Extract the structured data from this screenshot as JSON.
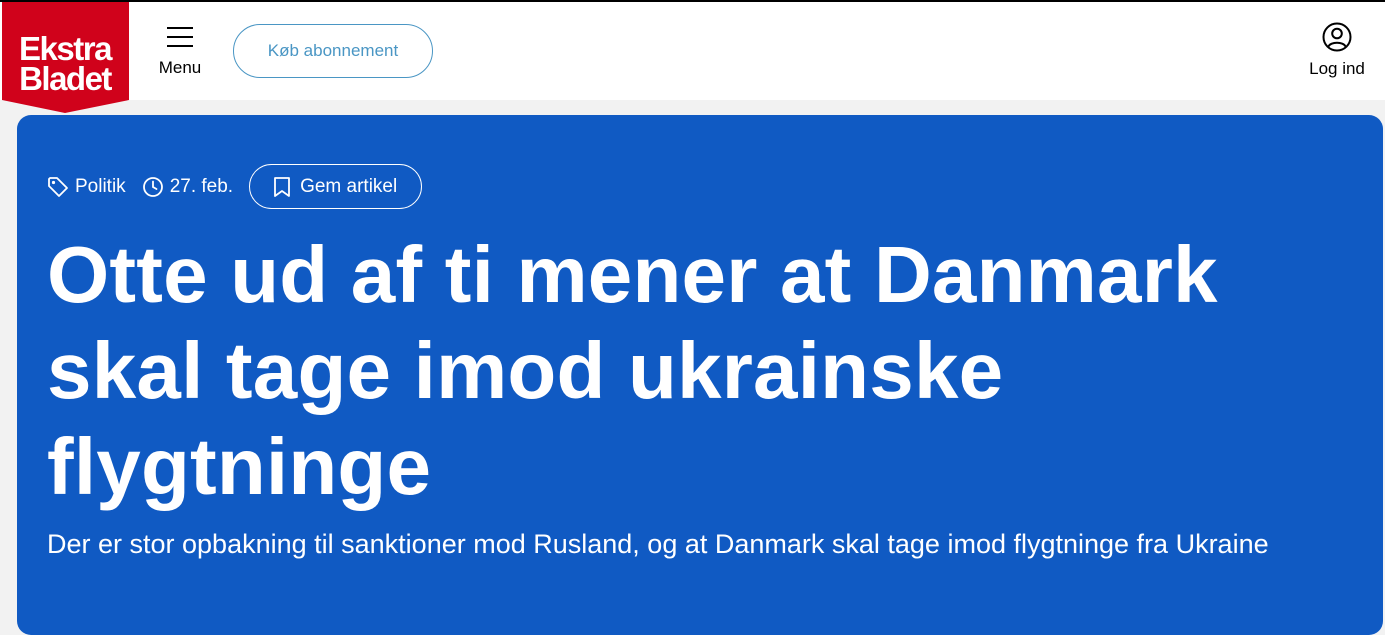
{
  "header": {
    "logo_alt": "Ekstra Bladet",
    "logo_line1": "Ekstra",
    "logo_line2": "Bladet",
    "menu_label": "Menu",
    "subscribe_label": "Køb abonnement",
    "login_label": "Log ind",
    "brand_color": "#d0021b",
    "accent_color": "#4a96c4"
  },
  "article": {
    "category": "Politik",
    "date": "27. feb.",
    "save_label": "Gem artikel",
    "headline": "Otte ud af ti mener at Danmark skal tage imod ukrainske flygtninge",
    "subheadline": "Der er stor opbakning til sanktioner mod Rusland, og at Danmark skal tage imod flygtninge fra Ukraine",
    "background_color": "#105ac3"
  },
  "icons": {
    "menu": "hamburger-icon",
    "login": "user-circle-icon",
    "category": "tag-icon",
    "date": "clock-icon",
    "save": "bookmark-icon"
  }
}
